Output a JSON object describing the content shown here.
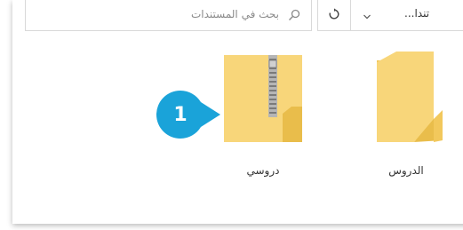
{
  "search": {
    "placeholder": "بحث في المستندات"
  },
  "address": {
    "path": "تندا..."
  },
  "items": [
    {
      "label": "دروسي",
      "type": "compressed-folder"
    },
    {
      "label": "الدروس",
      "type": "folder"
    }
  ],
  "callout": {
    "number": "1",
    "color": "#1aa3d9"
  },
  "colors": {
    "folder_body": "#f8d67a",
    "folder_back": "#f0c453",
    "zipper": "#9a9a9a"
  }
}
